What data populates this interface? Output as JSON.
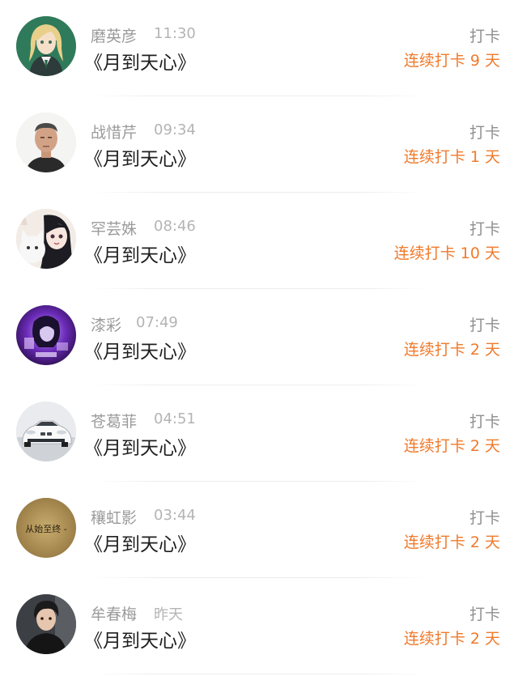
{
  "entries": [
    {
      "avatar": "anime-girl-avatar",
      "name": "磨英彦",
      "time": "11:30",
      "title": "《月到天心》",
      "action": "打卡",
      "streak": "连续打卡 9 天"
    },
    {
      "avatar": "man-portrait-avatar",
      "name": "战惜芹",
      "time": "09:34",
      "title": "《月到天心》",
      "action": "打卡",
      "streak": "连续打卡 1 天"
    },
    {
      "avatar": "cartoon-girl-cat-avatar",
      "name": "罕芸姝",
      "time": "08:46",
      "title": "《月到天心》",
      "action": "打卡",
      "streak": "连续打卡 10 天"
    },
    {
      "avatar": "purple-anime-avatar",
      "name": "漆彩",
      "time": "07:49",
      "title": "《月到天心》",
      "action": "打卡",
      "streak": "连续打卡 2 天"
    },
    {
      "avatar": "white-car-avatar",
      "name": "苍葛菲",
      "time": "04:51",
      "title": "《月到天心》",
      "action": "打卡",
      "streak": "连续打卡 2 天"
    },
    {
      "avatar": "text-paper-avatar",
      "avatar_text": "从始至终 -",
      "name": "穰虹影",
      "time": "03:44",
      "title": "《月到天心》",
      "action": "打卡",
      "streak": "连续打卡 2 天"
    },
    {
      "avatar": "young-man-avatar",
      "name": "牟春梅",
      "time": "昨天",
      "title": "《月到天心》",
      "action": "打卡",
      "streak": "连续打卡 2 天"
    }
  ],
  "colors": {
    "streak": "#f07a2b",
    "name": "#9b9b9b",
    "title": "#1f1f1f"
  }
}
